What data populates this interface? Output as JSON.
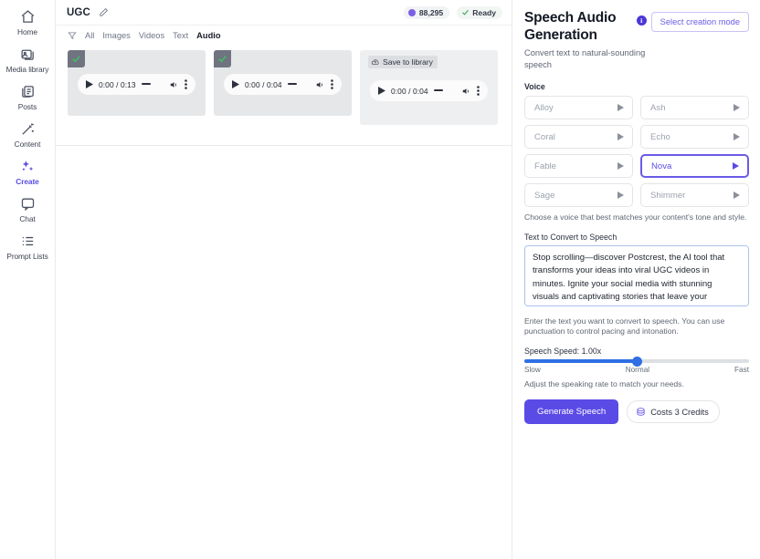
{
  "sidebar": {
    "items": [
      {
        "label": "Home",
        "icon": "home-icon",
        "active": false
      },
      {
        "label": "Media library",
        "icon": "media-library-icon",
        "active": false
      },
      {
        "label": "Posts",
        "icon": "posts-icon",
        "active": false
      },
      {
        "label": "Content",
        "icon": "content-wand-icon",
        "active": false
      },
      {
        "label": "Create",
        "icon": "sparkles-icon",
        "active": true
      },
      {
        "label": "Chat",
        "icon": "chat-bubble-icon",
        "active": false
      },
      {
        "label": "Prompt Lists",
        "icon": "list-icon",
        "active": false
      }
    ]
  },
  "topbar": {
    "project_title": "UGC",
    "edit_icon": "pencil-icon",
    "credits": "88,295",
    "credits_icon": "coin-icon",
    "status": "Ready",
    "status_icon": "check-icon"
  },
  "filters": {
    "funnel_icon": "filter-funnel-icon",
    "tabs": [
      {
        "label": "All",
        "active": false
      },
      {
        "label": "Images",
        "active": false
      },
      {
        "label": "Videos",
        "active": false
      },
      {
        "label": "Text",
        "active": false
      },
      {
        "label": "Audio",
        "active": true
      }
    ]
  },
  "media_cards": [
    {
      "selected": true,
      "time": "0:00 / 0:13",
      "save_label": null,
      "tall": false
    },
    {
      "selected": true,
      "time": "0:00 / 0:04",
      "save_label": null,
      "tall": false
    },
    {
      "selected": false,
      "time": "0:00 / 0:04",
      "save_label": "Save to library",
      "tall": true
    }
  ],
  "panel": {
    "title": "Speech Audio Generation",
    "info_icon": "info-icon",
    "mode_button": "Select creation mode",
    "subtitle": "Convert text to natural-sounding speech",
    "voice_label": "Voice",
    "voices": [
      {
        "name": "Alloy",
        "selected": false
      },
      {
        "name": "Ash",
        "selected": false
      },
      {
        "name": "Coral",
        "selected": false
      },
      {
        "name": "Echo",
        "selected": false
      },
      {
        "name": "Fable",
        "selected": false
      },
      {
        "name": "Nova",
        "selected": true
      },
      {
        "name": "Sage",
        "selected": false
      },
      {
        "name": "Shimmer",
        "selected": false
      }
    ],
    "voice_hint": "Choose a voice that best matches your content's tone and style.",
    "text_label": "Text to Convert to Speech",
    "text_value": "Stop scrolling—discover Postcrest, the AI tool that transforms your ideas into viral UGC videos in minutes. Ignite your social media with stunning visuals and captivating stories that leave your audience wanting more!",
    "text_placeholder": "Enter the text you want to convert to speech",
    "text_hint": "Enter the text you want to convert to speech. You can use punctuation to control pacing and intonation.",
    "speed_label": "Speech Speed: 1.00x",
    "speed_value": "1.00",
    "speed_min": "0.25",
    "speed_max": "4.00",
    "speed_ticks": {
      "slow": "Slow",
      "normal": "Normal",
      "fast": "Fast"
    },
    "speed_hint": "Adjust the speaking rate to match your needs.",
    "generate_button": "Generate Speech",
    "cost_label": "Costs 3 Credits",
    "cost_icon": "credit-coin-icon"
  },
  "colors": {
    "accent_purple": "#5b4be6",
    "slider_blue": "#2f6fe4",
    "ready_green": "#3aa760"
  }
}
